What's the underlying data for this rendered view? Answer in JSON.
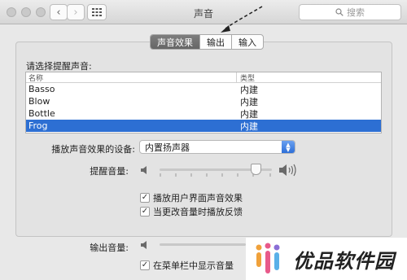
{
  "window": {
    "title": "声音",
    "search_placeholder": "搜索"
  },
  "tabs": [
    {
      "label": "声音效果",
      "active": true
    },
    {
      "label": "输出",
      "active": false
    },
    {
      "label": "输入",
      "active": false
    }
  ],
  "sound_effects": {
    "prompt": "请选择提醒声音:",
    "columns": [
      "名称",
      "类型"
    ],
    "rows": [
      {
        "name": "Basso",
        "type": "内建",
        "selected": false
      },
      {
        "name": "Blow",
        "type": "内建",
        "selected": false
      },
      {
        "name": "Bottle",
        "type": "内建",
        "selected": false
      },
      {
        "name": "Frog",
        "type": "内建",
        "selected": true
      }
    ],
    "device_label": "播放声音效果的设备:",
    "device_value": "内置扬声器",
    "alert_volume_label": "提醒音量:",
    "alert_volume_level": 0.86,
    "ui_sound_label": "播放用户界面声音效果",
    "ui_sound_checked": true,
    "feedback_label": "当更改音量时播放反馈",
    "feedback_checked": true
  },
  "output_volume": {
    "label": "输出音量:",
    "menubar_label": "在菜单栏中显示音量",
    "menubar_checked": true
  },
  "watermark": {
    "text": "优品软件园"
  },
  "colors": {
    "selection": "#2d6fd3",
    "accent": "#2e6fd8"
  }
}
